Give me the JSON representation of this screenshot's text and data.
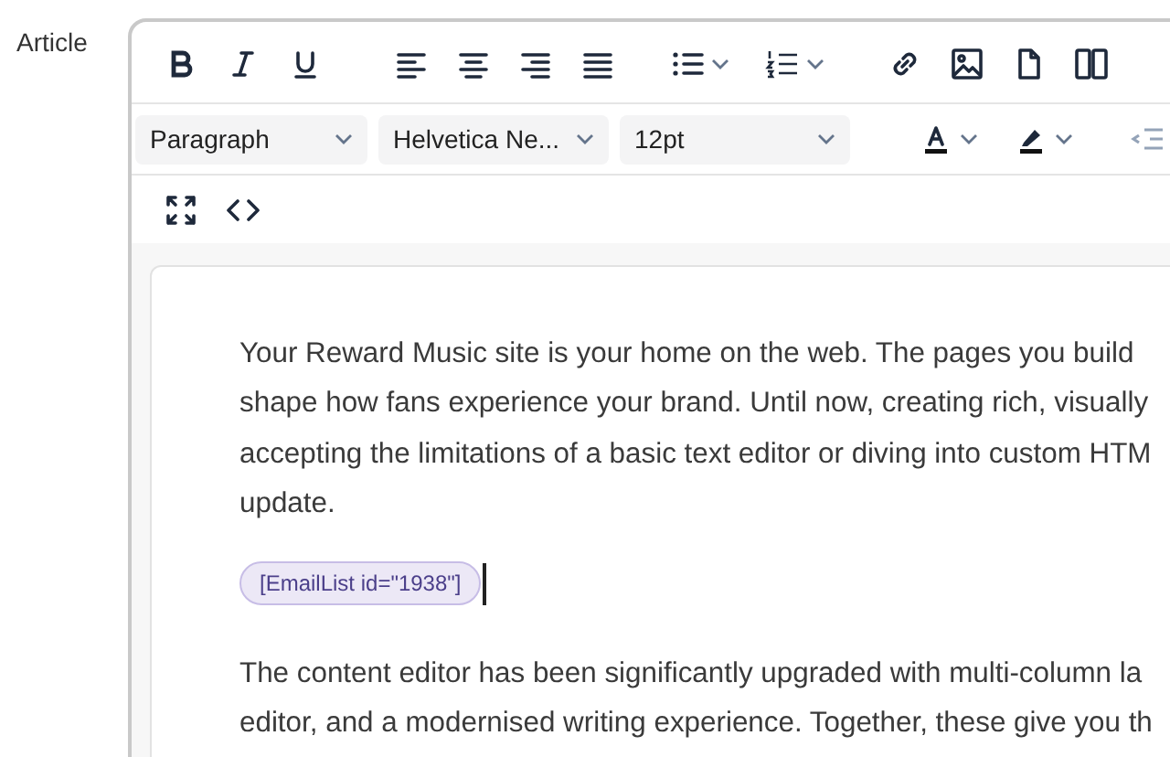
{
  "field_label": "Article",
  "toolbar": {
    "selects": [
      {
        "value": "Paragraph"
      },
      {
        "value": "Helvetica Ne..."
      },
      {
        "value": "12pt"
      }
    ]
  },
  "content": {
    "paragraphs": [
      {
        "lines": [
          "Your Reward Music site is your home on the web. The pages you build",
          "shape how fans experience your brand. Until now, creating rich, visually",
          "accepting the limitations of a basic text editor or diving into custom HTM",
          "update."
        ]
      }
    ],
    "shortcode": "[EmailList id=\"1938\"]",
    "after_paragraphs": [
      {
        "lines": [
          "The content editor has been significantly upgraded with multi-column la",
          "editor, and a modernised writing experience. Together, these give you th"
        ]
      }
    ]
  }
}
